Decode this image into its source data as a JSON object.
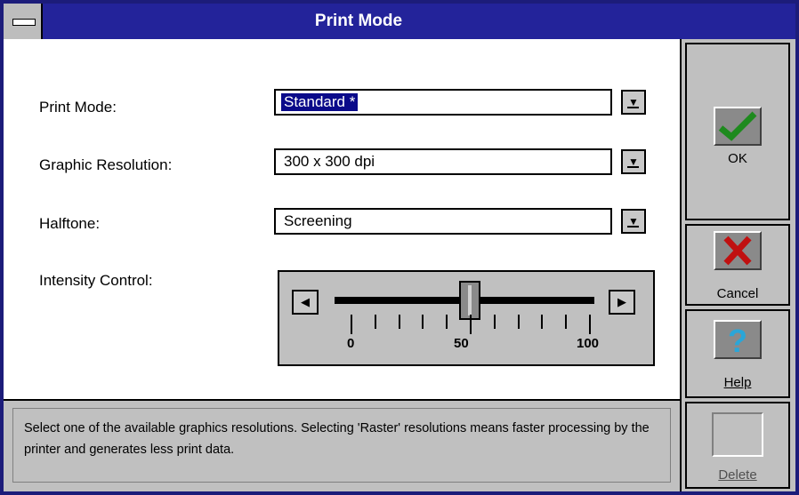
{
  "window": {
    "title": "Print Mode"
  },
  "fields": {
    "print_mode": {
      "label": "Print Mode:",
      "value": "Standard *"
    },
    "graphic_resolution": {
      "label": "Graphic Resolution:",
      "value": "300 x 300 dpi"
    },
    "halftone": {
      "label": "Halftone:",
      "value": "Screening"
    },
    "intensity": {
      "label": "Intensity Control:",
      "level": 50,
      "min_label": "0",
      "mid_label": "50",
      "max_label": "100"
    }
  },
  "status": {
    "text": "Select one of the available graphics resolutions. Selecting 'Raster' resolutions means faster processing by the printer and generates less print data."
  },
  "buttons": {
    "ok": "OK",
    "cancel": "Cancel",
    "help": "Help",
    "delete": "Delete"
  },
  "icons": {
    "ok": "checkmark-icon",
    "cancel": "x-icon",
    "help": "question-mark-icon",
    "combo": "down-arrow-icon"
  },
  "colors": {
    "title_bar": "#23239a",
    "selection": "#0a0a8a",
    "ok_check": "#1e8a1e",
    "cancel_x": "#c01010",
    "help_q": "#2aa6d8"
  }
}
